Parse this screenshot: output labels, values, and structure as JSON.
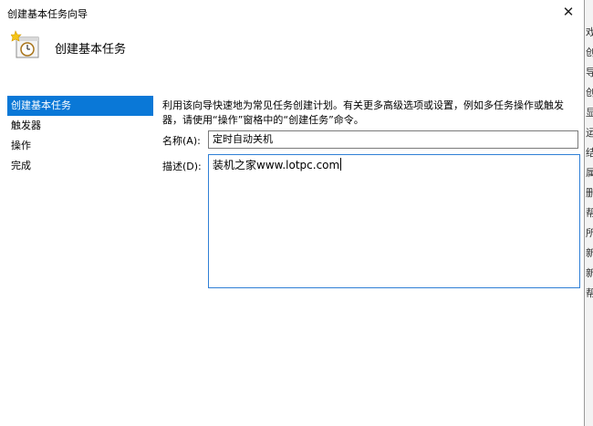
{
  "window": {
    "title": "创建基本任务向导",
    "close_icon": "close-icon",
    "header_title": "创建基本任务",
    "header_icon": "task-clock-icon"
  },
  "nav": {
    "items": [
      {
        "label": "创建基本任务",
        "selected": true
      },
      {
        "label": "触发器",
        "selected": false
      },
      {
        "label": "操作",
        "selected": false
      },
      {
        "label": "完成",
        "selected": false
      }
    ]
  },
  "content": {
    "intro": "利用该向导快速地为常见任务创建计划。有关更多高级选项或设置，例如多任务操作或触发器，请使用“操作”窗格中的“创建任务”命令。",
    "name_label": "名称(A):",
    "name_value": "定时自动关机",
    "desc_label": "描述(D):",
    "desc_value": "装机之家www.lotpc.com"
  },
  "background": {
    "right_chars": [
      "戏",
      "创",
      "导",
      "创",
      "显",
      "运",
      "结",
      "属",
      "删",
      "帮",
      "所",
      "新",
      "新",
      "帮"
    ]
  },
  "colors": {
    "selection": "#0a78d7",
    "focus_border": "#2f7fd6"
  }
}
